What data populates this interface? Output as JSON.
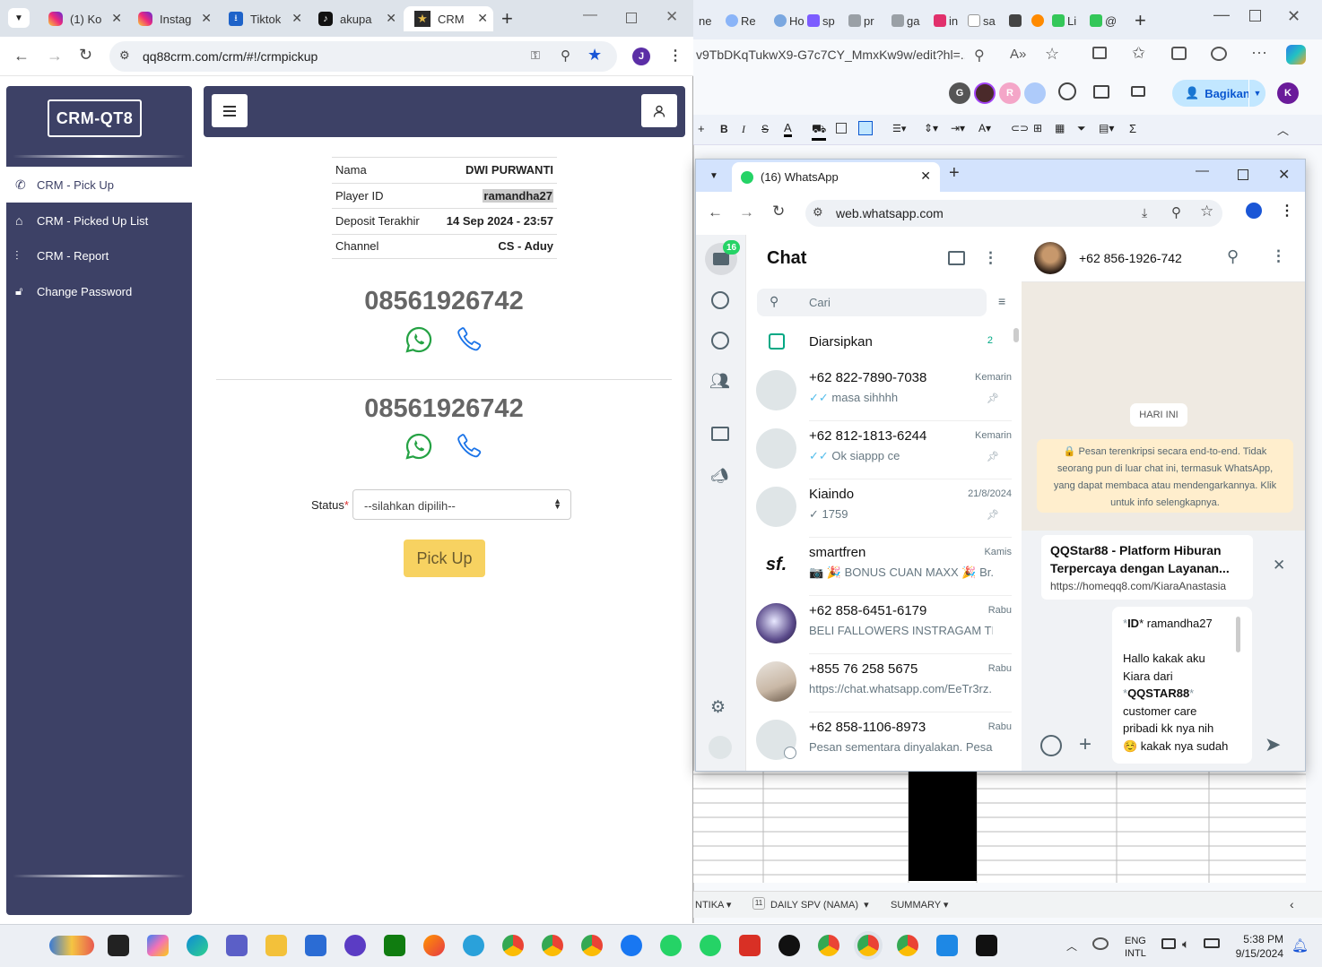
{
  "left_browser": {
    "tabs": [
      {
        "label": "(1) Ko",
        "icon": "instagram-icon"
      },
      {
        "label": "Instag",
        "icon": "instagram-icon"
      },
      {
        "label": "Tiktok",
        "icon": "download-icon"
      },
      {
        "label": "akupa",
        "icon": "tiktok-icon"
      },
      {
        "label": "CRM",
        "icon": "crm-star-icon"
      }
    ],
    "url": "qq88crm.com/crm/#!/crmpickup",
    "profile_initial": "J"
  },
  "crm": {
    "logo": "CRM-QT8",
    "menu": [
      {
        "label": "CRM - Pick Up",
        "icon": "phone-icon"
      },
      {
        "label": "CRM - Picked Up List",
        "icon": "tag-icon"
      },
      {
        "label": "CRM - Report",
        "icon": "sliders-icon"
      },
      {
        "label": "Change Password",
        "icon": "lock-icon"
      }
    ],
    "info": [
      {
        "label": "Nama",
        "value": "DWI PURWANTI"
      },
      {
        "label": "Player ID",
        "value": "ramandha27"
      },
      {
        "label": "Deposit Terakhir",
        "value": "14 Sep 2024 - 23:57"
      },
      {
        "label": "Channel",
        "value": "CS - Aduy"
      }
    ],
    "phones": [
      "08561926742",
      "08561926742"
    ],
    "status_label": "Status",
    "status_required": "*",
    "status_placeholder": "--silahkan dipilih--",
    "pickup_label": "Pick Up"
  },
  "bg_window": {
    "tabs": [
      "ne",
      "Re",
      "Ho",
      "sp",
      "pr",
      "ga",
      "in",
      "sa",
      "",
      "",
      "Li",
      "@"
    ],
    "url": "v9TbDKqTukwX9-G7c7CY_MmxKw9w/edit?hl=...",
    "share_label": "Bagikan",
    "collab_initials": [
      "G",
      "",
      "R"
    ],
    "profile_initial": "K",
    "sheet_tabs": [
      {
        "label": "NTIKA"
      },
      {
        "label": "DAILY SPV (NAMA)",
        "badge": "11"
      },
      {
        "label": "SUMMARY"
      }
    ]
  },
  "whatsapp": {
    "tab_title": "(16) WhatsApp",
    "url": "web.whatsapp.com",
    "unread_badge": "16",
    "list_title": "Chat",
    "search_placeholder": "Cari",
    "archived_label": "Diarsipkan",
    "archived_count": "2",
    "chats": [
      {
        "name": "+62 822-7890-7038",
        "time": "Kemarin",
        "preview": "masa sihhhh",
        "tick": "✓✓",
        "pinned": true
      },
      {
        "name": "+62 812-1813-6244",
        "time": "Kemarin",
        "preview": "Ok siappp ce",
        "tick": "✓✓",
        "pinned": true
      },
      {
        "name": "Kiaindo",
        "time": "21/8/2024",
        "preview": "1759",
        "tick": "✓",
        "pinned": true
      },
      {
        "name": "smartfren",
        "time": "Kamis",
        "preview": "📷 🎉 BONUS CUAN MAXX 🎉 Br...",
        "tick": "",
        "pinned": false
      },
      {
        "name": "+62 858-6451-6179",
        "time": "Rabu",
        "preview": "BELI FALLOWERS INSTRAGAM TIKT...",
        "tick": "",
        "pinned": false
      },
      {
        "name": "+855 76 258 5675",
        "time": "Rabu",
        "preview": "https://chat.whatsapp.com/EeTr3rz...",
        "tick": "",
        "pinned": false
      },
      {
        "name": "+62 858-1106-8973",
        "time": "Rabu",
        "preview": "Pesan sementara dinyalakan. Pesan...",
        "tick": "",
        "pinned": false
      }
    ],
    "contact_name": "+62 856-1926-742",
    "day_label": "HARI INI",
    "e2e_notice": "🔒 Pesan terenkripsi secara end-to-end. Tidak seorang pun di luar chat ini, termasuk WhatsApp, yang dapat membaca atau mendengarkannya. Klik untuk info selengkapnya.",
    "link_preview": {
      "title": "QQStar88 - Platform Hiburan Terpercaya dengan Layanan...",
      "url": "https://homeqq8.com/KiaraAnastasia"
    },
    "compose": {
      "id_prefix": "*",
      "id_label": "ID",
      "id_suffix": "* ramandha27",
      "line1": "Hallo kakak aku",
      "line2": "Kiara dari",
      "brand_prefix": "*",
      "brand": "QQSTAR88",
      "brand_suffix": "*",
      "line3": "customer care",
      "line4": "pribadi kk nya nih",
      "line5": "☺️ kakak nya sudah"
    }
  },
  "taskbar": {
    "lang_top": "ENG",
    "lang_bottom": "INTL",
    "time": "5:38 PM",
    "date": "9/15/2024"
  }
}
